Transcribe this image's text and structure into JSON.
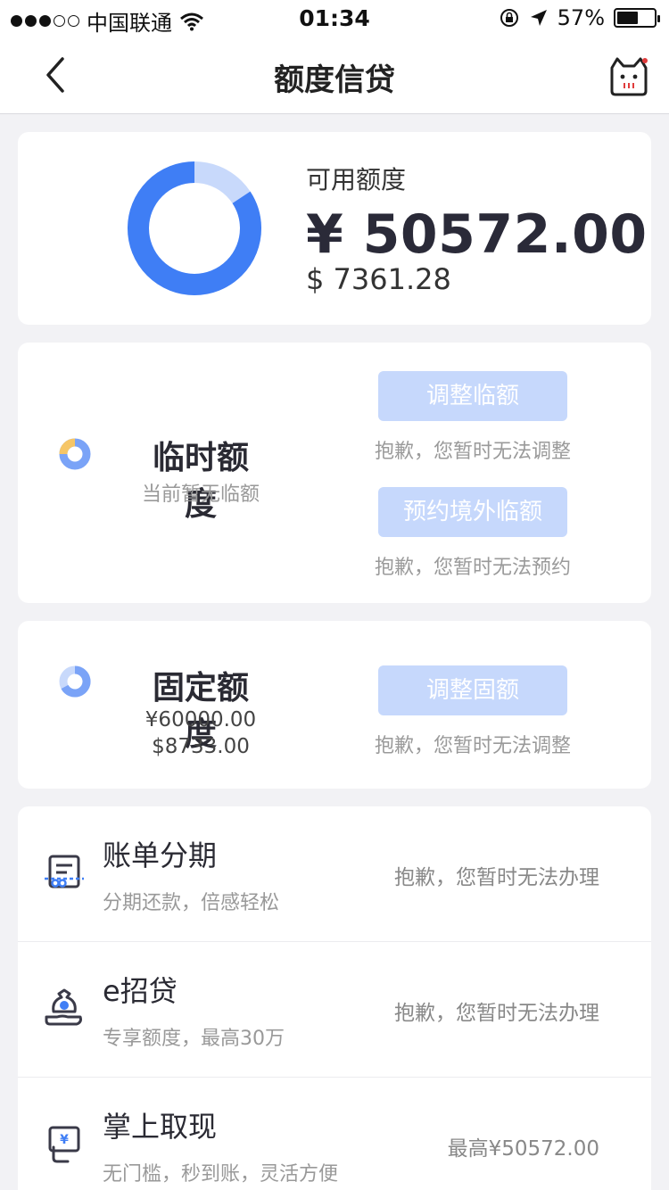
{
  "status_bar": {
    "carrier": "中国联通",
    "time": "01:34",
    "battery_percent": "57%",
    "signal_dots_filled": 3,
    "signal_dots_total": 5
  },
  "nav": {
    "title": "额度信贷",
    "back_icon": "chevron-left-icon",
    "mascot_icon": "cat-mascot-icon"
  },
  "available": {
    "label": "可用额度",
    "cny": "¥ 50572.00",
    "usd": "$ 7361.28",
    "ratio": 0.843,
    "colors": {
      "used": "#c8d9fb",
      "available": "#3f7ef5"
    }
  },
  "temporary": {
    "title": "临时额度",
    "subtitle": "当前暂无临额",
    "adjust_button": "调整临额",
    "adjust_note": "抱歉，您暂时无法调整",
    "overseas_button": "预约境外临额",
    "overseas_note": "抱歉，您暂时无法预约"
  },
  "fixed": {
    "title": "固定额度",
    "cny": "¥60000.00",
    "usd": "$8733.00",
    "adjust_button": "调整固额",
    "adjust_note": "抱歉，您暂时无法调整"
  },
  "services": [
    {
      "title": "账单分期",
      "subtitle": "分期还款，倍感轻松",
      "status": "抱歉，您暂时无法办理",
      "icon": "bill-installment-icon"
    },
    {
      "title": "e招贷",
      "subtitle": "专享额度，最高30万",
      "status": "抱歉，您暂时无法办理",
      "icon": "money-bag-hand-icon"
    },
    {
      "title": "掌上取现",
      "subtitle": "无门槛，秒到账，灵活方便",
      "status": "最高¥50572.00",
      "icon": "cash-withdraw-icon"
    }
  ]
}
